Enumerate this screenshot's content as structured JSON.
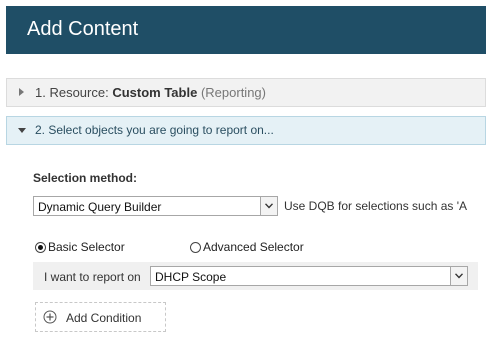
{
  "header": {
    "title": "Add Content"
  },
  "steps": [
    {
      "number": "1. Resource: ",
      "resource": "Custom Table",
      "category": "(Reporting)"
    },
    {
      "label": "2. Select objects you are going to report on..."
    }
  ],
  "selection": {
    "label": "Selection method:",
    "method_value": "Dynamic Query Builder",
    "note": "Use DQB for selections such as 'A"
  },
  "selector": {
    "options": [
      "Basic Selector",
      "Advanced Selector"
    ],
    "selected": "Basic Selector"
  },
  "report": {
    "label": "I want to report on",
    "value": "DHCP Scope"
  },
  "add_condition": {
    "label": "Add Condition"
  },
  "icons": {
    "collapsed": "triangle-right-icon",
    "expanded": "triangle-down-icon",
    "dropdown": "chevron-down-icon",
    "add": "plus-circle-icon"
  }
}
